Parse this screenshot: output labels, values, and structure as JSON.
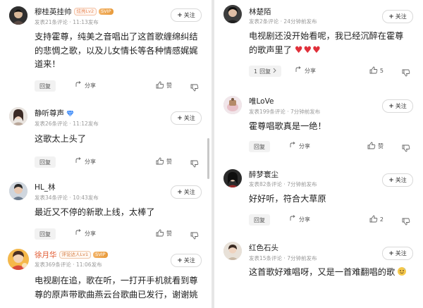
{
  "colors": {
    "accent": "#e0552b",
    "svip": "#e89a3a",
    "heart": "#e0303a",
    "verified": "#3d8af7"
  },
  "follow_label": "关注",
  "reply_label": "回复",
  "share_label": "分享",
  "like_label": "赞",
  "left_comments": [
    {
      "name": "穆桂英挂帅",
      "badges": [
        "炫亮Lv2",
        "SVIP"
      ],
      "meta": "发表21条评论 · 11:13发布",
      "text": "支持霍尊，纯美之音唱出了这首歌缠绵纠结的悲惆之歌，以及儿女情长等各种情感娓娓道来！",
      "likes": "赞"
    },
    {
      "name": "静听尊声",
      "meta": "发表26条评论 · 11:12发布",
      "text": "这歌太上头了",
      "likes": "赞"
    },
    {
      "name": "HL_林",
      "meta": "发表34条评论 · 10:43发布",
      "text": "最近又不停的新歌上线，太棒了",
      "likes": "赞"
    },
    {
      "name": "徐月华",
      "badges": [
        "评论达人Lv1",
        "SVIP"
      ],
      "meta": "发表369条评论 · 11:06发布",
      "text": "电视剧在追，歌在听，一打开手机就看到尊尊的原声带歌曲燕云台歌曲已发行，谢谢姚"
    }
  ],
  "right_comments": [
    {
      "name": "林楚陌",
      "meta": "发表2条评论 · 24分钟前发布",
      "text": "电视剧还没开始看呢，我已经沉醉在霍尊的歌声里了",
      "hearts": "♥♥♥",
      "reply_count": "1",
      "likes": "5"
    },
    {
      "name": "唯LoVe",
      "meta": "发表199条评论 · 7分钟前发布",
      "text": "霍尊唱歌真是一绝！",
      "likes": "赞"
    },
    {
      "name": "醉梦寰尘",
      "meta": "发表82条评论 · 7分钟前发布",
      "text": "好好听，符合大草原",
      "likes": "2"
    },
    {
      "name": "红色石头",
      "meta": "发表15条评论 · 7分钟前发布",
      "text": "这首歌好难唱呀，又是一首难翻唱的歌"
    }
  ]
}
